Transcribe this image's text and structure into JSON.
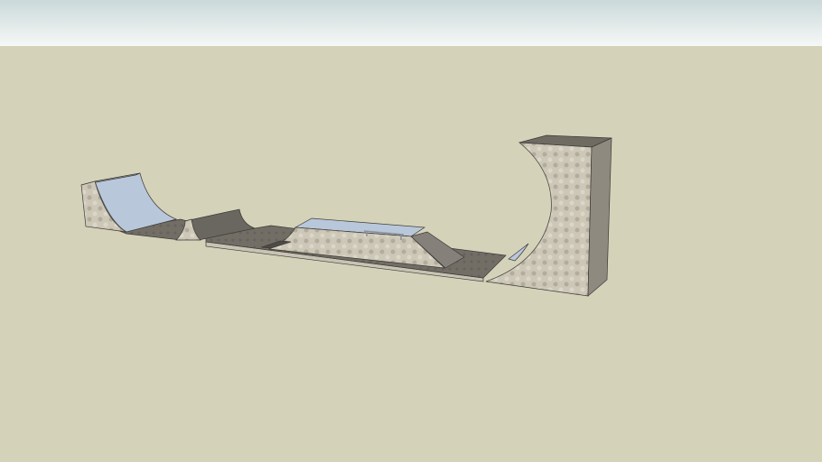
{
  "colors": {
    "sky_top": "#cfdcdc",
    "sky_bottom": "#f4f7f5",
    "ground": "#d4d2b9",
    "concrete": "#c9c2b2",
    "concrete_dark": "#7d7a72",
    "floor": "#6f6b63",
    "coping_blue": "#b9c7da"
  }
}
